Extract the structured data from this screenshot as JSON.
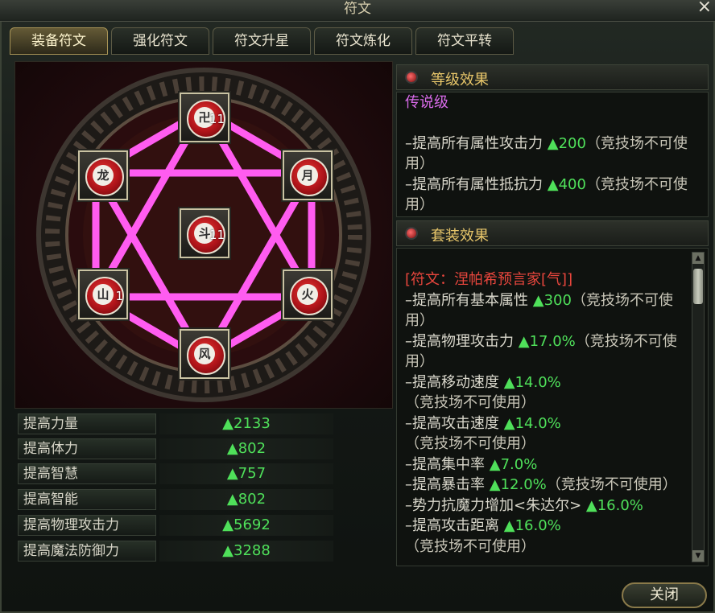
{
  "window": {
    "title": "符文"
  },
  "tabs": [
    {
      "label": "装备符文",
      "active": true
    },
    {
      "label": "强化符文",
      "active": false
    },
    {
      "label": "符文升星",
      "active": false
    },
    {
      "label": "符文炼化",
      "active": false
    },
    {
      "label": "符文平转",
      "active": false
    }
  ],
  "runes": [
    {
      "slot": "top",
      "glyph": "卍",
      "level": "11"
    },
    {
      "slot": "upper-left",
      "glyph": "龙",
      "level": ""
    },
    {
      "slot": "upper-right",
      "glyph": "月",
      "level": ""
    },
    {
      "slot": "center",
      "glyph": "斗",
      "level": "11"
    },
    {
      "slot": "lower-left",
      "glyph": "山",
      "level": "1"
    },
    {
      "slot": "lower-right",
      "glyph": "火",
      "level": ""
    },
    {
      "slot": "bottom",
      "glyph": "风",
      "level": ""
    }
  ],
  "stats": [
    {
      "name": "提高力量",
      "value": "▲2133"
    },
    {
      "name": "提高体力",
      "value": "▲802"
    },
    {
      "name": "提高智慧",
      "value": "▲757"
    },
    {
      "name": "提高智能",
      "value": "▲802"
    },
    {
      "name": "提高物理攻击力",
      "value": "▲5692"
    },
    {
      "name": "提高魔法防御力",
      "value": "▲3288"
    }
  ],
  "level_effect": {
    "header": "等级效果",
    "grade": "传说级",
    "lines": [
      {
        "text": "–提高所有属性攻击力 ",
        "value": "▲200",
        "note": "（竞技场不可使用）"
      },
      {
        "text": "–提高所有属性抵抗力 ",
        "value": "▲400",
        "note": "（竞技场不可使用）"
      }
    ]
  },
  "set_effect": {
    "header": "套装效果",
    "set_name": "[符文：涅帕希预言家[气]]",
    "lines": [
      {
        "text": "–提高所有基本属性 ",
        "value": "▲300",
        "note": "（竞技场不可使用）"
      },
      {
        "text": "–提高物理攻击力 ",
        "value": "▲17.0%",
        "note": "（竞技场不可使用）"
      },
      {
        "text": "–提高移动速度 ",
        "value": "▲14.0%",
        "note": "（竞技场不可使用）"
      },
      {
        "text": "–提高攻击速度 ",
        "value": "▲14.0%",
        "note": "（竞技场不可使用）"
      },
      {
        "text": "–提高集中率 ",
        "value": "▲7.0%",
        "note": ""
      },
      {
        "text": "–提高暴击率 ",
        "value": "▲12.0%",
        "note": "（竞技场不可使用）"
      },
      {
        "text": "–势力抗魔力增加<朱达尔> ",
        "value": "▲16.0%",
        "note": ""
      },
      {
        "text": "–提高攻击距离 ",
        "value": "▲16.0%",
        "note": "（竞技场不可使用）"
      }
    ]
  },
  "buttons": {
    "close": "关闭"
  },
  "colors": {
    "magic_circle": "#ff5cf0",
    "value_green": "#4fe05a",
    "grade_purple": "#d96bea",
    "set_red": "#e8463d",
    "header_gold": "#e8c66a"
  }
}
